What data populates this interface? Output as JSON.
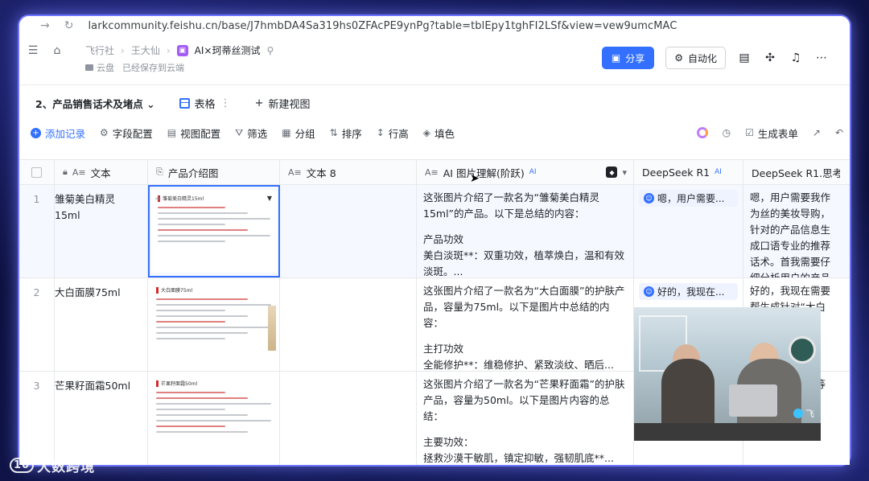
{
  "browser": {
    "url": "larkcommunity.feishu.cn/base/J7hmbDA4Sa319hs0ZFAcPE9ynPg?table=tblEpy1tghFI2LSf&view=vew9umcMAC"
  },
  "header": {
    "breadcrumb": [
      "飞行社",
      "王大仙"
    ],
    "doc_title": "AI×珂蒂丝测试",
    "location": "云盘",
    "save_status": "已经保存到云端",
    "share_label": "分享",
    "automation_label": "自动化"
  },
  "viewbar": {
    "table_name": "2、产品销售话术及堵点",
    "view_tab": "表格",
    "new_view": "新建视图"
  },
  "toolbar": {
    "add_record": "添加记录",
    "field_config": "字段配置",
    "view_config": "视图配置",
    "filter": "筛选",
    "group": "分组",
    "sort": "排序",
    "row_height": "行高",
    "fill_color": "填色",
    "generate_form": "生成表单"
  },
  "columns": {
    "text": "文本",
    "product_image": "产品介绍图",
    "text8": "文本 8",
    "ai_image": "AI 图片理解(阶跃)",
    "ai_tag": "AI",
    "deepseek": "DeepSeek R1",
    "deepseek_think": "DeepSeek R1.思考"
  },
  "rows": [
    {
      "num": "1",
      "name": "雏菊美白精灵15ml",
      "thumb_title": "雏菊美白精灵15ml",
      "ai_intro": "这张图片介绍了一款名为“雏菊美白精灵15ml”的产品。以下是总结的内容：",
      "ai_detail": "产品功效\n美白淡斑**：双重功效，植萃焕白，温和有效淡斑。...",
      "ds": "嗯，用户需要...",
      "ds_think": "嗯，用户需要我作为丝的美妆导购，针对的产品信息生成口语专业的推荐话术。首我需要仔细分析用户的产品详情，找出关键"
    },
    {
      "num": "2",
      "name": "大白面膜75ml",
      "thumb_title": "大白面膜75ml",
      "ai_intro": "这张图片介绍了一款名为“大白面膜”的护肤产品，容量为75ml。以下是图片中总结的内容：",
      "ai_detail": "主打功效\n全能修护**：维稳修护、紧致淡纹、晒后...",
      "ds": "好的，我现在...",
      "ds_think": "好的，我现在需要帮生成针对“大白面膜荐话术。首先，我"
    },
    {
      "num": "3",
      "name": "芒果籽面霜50ml",
      "thumb_title": "芒果籽面霜50ml",
      "ai_intro": "这张图片介绍了一款名为“芒果籽面霜”的护肤产品，容量为50ml。以下是图片内容的总结：",
      "ai_detail": "主要功效：\n拯救沙漠干敏肌，镇定抑敏，强韧肌底**...",
      "ds": "",
      "ds_think": "要“芒飞的成分等信息"
    }
  ],
  "video": {
    "watermark": "飞"
  },
  "brand": {
    "logo": "10",
    "text": "大数跨境"
  }
}
